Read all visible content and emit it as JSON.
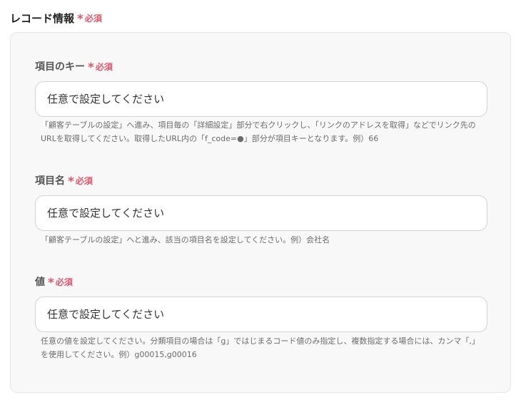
{
  "section": {
    "title": "レコード情報",
    "required_star": "*",
    "required_text": "必須"
  },
  "fields": [
    {
      "label": "項目のキー",
      "required_star": "*",
      "required_text": "必須",
      "placeholder": "任意で設定してください",
      "value": "",
      "hint": "「顧客テーブルの設定」へ進み、項目毎の「詳細設定」部分で右クリックし、「リンクのアドレスを取得」などでリンク先のURLを取得してください。取得したURL内の「f_code=●」部分が項目キーとなります。例）66"
    },
    {
      "label": "項目名",
      "required_star": "*",
      "required_text": "必須",
      "placeholder": "任意で設定してください",
      "value": "",
      "hint": "「顧客テーブルの設定」へと進み、該当の項目名を設定してください。例）会社名"
    },
    {
      "label": "値",
      "required_star": "*",
      "required_text": "必須",
      "placeholder": "任意で設定してください",
      "value": "",
      "hint": "任意の値を設定してください。分類項目の場合は「g」ではじまるコード値のみ指定し、複数指定する場合には、カンマ「,」を使用してください。例）g00015,g00016"
    }
  ]
}
